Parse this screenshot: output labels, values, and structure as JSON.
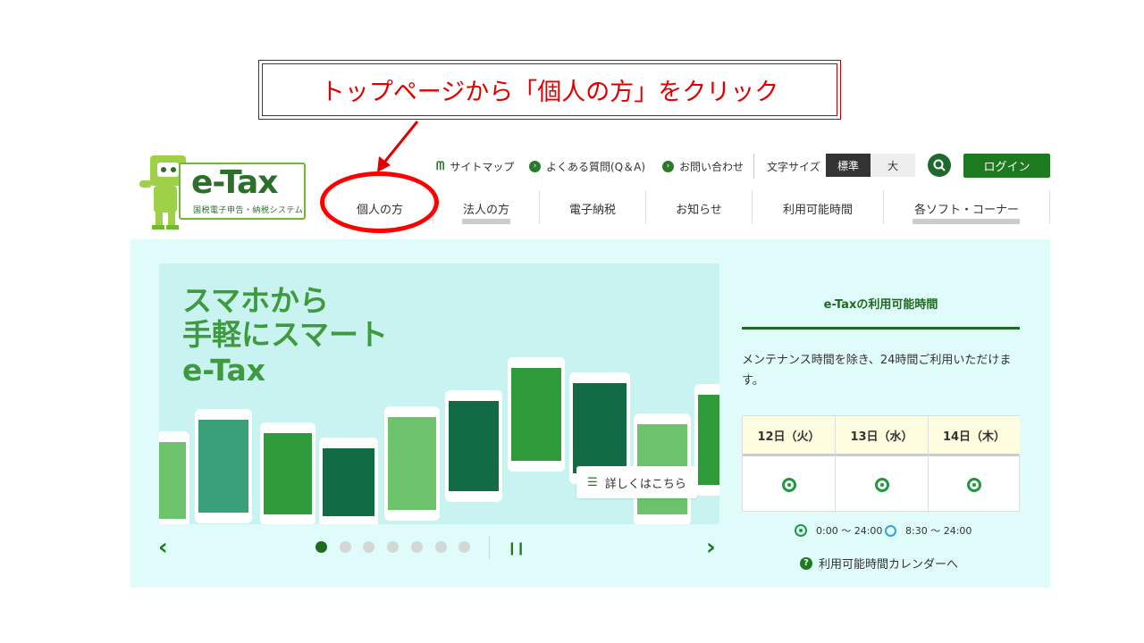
{
  "callout": {
    "text": "トップページから「個人の方」をクリック",
    "color": "#e00000"
  },
  "logo": {
    "name": "e-Tax",
    "subtitle": "国税電子申告・納税システム"
  },
  "utility_nav": {
    "sitemap": "サイトマップ",
    "faq": "よくある質問(Q＆A)",
    "contact": "お問い合わせ",
    "font_size_label": "文字サイズ",
    "font_standard": "標準",
    "font_large": "大",
    "login": "ログイン"
  },
  "main_nav": [
    "個人の方",
    "法人の方",
    "電子納税",
    "お知らせ",
    "利用可能時間",
    "各ソフト・コーナー"
  ],
  "banner": {
    "title_lines": [
      "スマホから",
      "手軽にスマート",
      "e-Tax"
    ],
    "more_button": "詳しくはこちら",
    "slide_count": 7,
    "active_slide": 1
  },
  "availability": {
    "title": "e-Taxの利用可能時間",
    "description": "メンテナンス時間を除き、24時間ご利用いただけます。",
    "days": [
      "12日（火）",
      "13日（水）",
      "14日（木）"
    ],
    "legend_full": "0:00 ～ 24:00",
    "legend_partial": "8:30 ～ 24:00",
    "calendar_link": "利用可能時間カレンダーへ"
  },
  "colors": {
    "brand_green": "#1e7a1e",
    "accent_light_green": "#6fb92c",
    "panel_bg": "#dffbfa"
  }
}
